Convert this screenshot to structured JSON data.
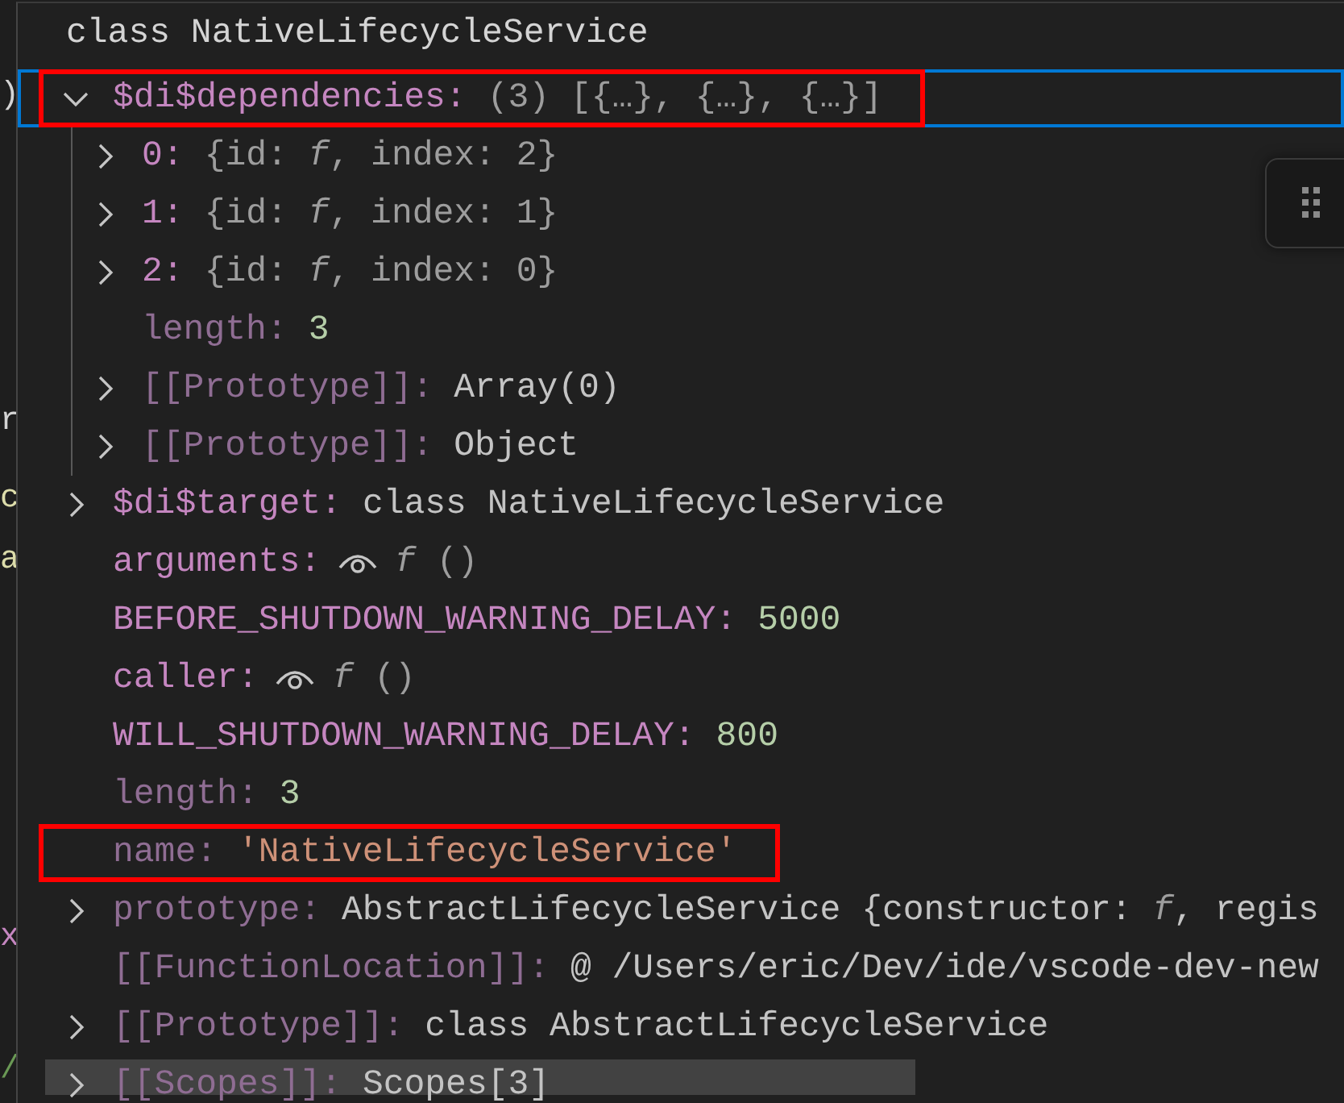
{
  "editor_fragments": [
    {
      "text": ")",
      "color": "#d4d4d4"
    },
    {
      "text": "r",
      "color": "#d4d4d4"
    },
    {
      "text": "c",
      "color": "#dcdcaa"
    },
    {
      "text": "a",
      "color": "#dcdcaa"
    },
    {
      "text": "x",
      "color": "#c586c0"
    },
    {
      "text": "/",
      "color": "#6a9955"
    }
  ],
  "hover": {
    "title": "class NativeLifecycleService",
    "rows": [
      {
        "name": "$di$dependencies:",
        "dim": false,
        "expanded": true,
        "selected": true,
        "annotated": true,
        "value": [
          {
            "text": "(3) [{…}, {…}, {…}]",
            "kind": "preview"
          }
        ],
        "children": [
          {
            "name": "0:",
            "dim": false,
            "expanded": false,
            "selected": false,
            "annotated": false,
            "value": [
              {
                "text": "{id: ",
                "kind": "preview"
              },
              {
                "text": "f",
                "kind": "function"
              },
              {
                "text": ", index: 2}",
                "kind": "preview"
              }
            ]
          },
          {
            "name": "1:",
            "dim": false,
            "expanded": false,
            "selected": false,
            "annotated": false,
            "value": [
              {
                "text": "{id: ",
                "kind": "preview"
              },
              {
                "text": "f",
                "kind": "function"
              },
              {
                "text": ", index: 1}",
                "kind": "preview"
              }
            ]
          },
          {
            "name": "2:",
            "dim": false,
            "expanded": false,
            "selected": false,
            "annotated": false,
            "value": [
              {
                "text": "{id: ",
                "kind": "preview"
              },
              {
                "text": "f",
                "kind": "function"
              },
              {
                "text": ", index: 0}",
                "kind": "preview"
              }
            ]
          },
          {
            "name": "length:",
            "dim": true,
            "selected": false,
            "annotated": false,
            "value": [
              {
                "text": "3",
                "kind": "number"
              }
            ]
          },
          {
            "name": "[[Prototype]]:",
            "dim": true,
            "expanded": false,
            "selected": false,
            "annotated": false,
            "value": [
              {
                "text": "Array(0)",
                "kind": "object"
              }
            ]
          },
          {
            "name": "[[Prototype]]:",
            "dim": true,
            "expanded": false,
            "selected": false,
            "annotated": false,
            "value": [
              {
                "text": "Object",
                "kind": "object"
              }
            ]
          }
        ]
      },
      {
        "name": "$di$target:",
        "dim": false,
        "expanded": false,
        "selected": false,
        "annotated": false,
        "value": [
          {
            "text": "class NativeLifecycleService",
            "kind": "object"
          }
        ]
      },
      {
        "name": "arguments:",
        "dim": false,
        "getter": true,
        "selected": false,
        "annotated": false,
        "value": [
          {
            "text": "f",
            "kind": "function"
          },
          {
            "text": " ()",
            "kind": "preview"
          }
        ]
      },
      {
        "name": "BEFORE_SHUTDOWN_WARNING_DELAY:",
        "dim": false,
        "selected": false,
        "annotated": false,
        "value": [
          {
            "text": "5000",
            "kind": "number"
          }
        ]
      },
      {
        "name": "caller:",
        "dim": false,
        "getter": true,
        "selected": false,
        "annotated": false,
        "value": [
          {
            "text": "f",
            "kind": "function"
          },
          {
            "text": " ()",
            "kind": "preview"
          }
        ]
      },
      {
        "name": "WILL_SHUTDOWN_WARNING_DELAY:",
        "dim": false,
        "selected": false,
        "annotated": false,
        "value": [
          {
            "text": "800",
            "kind": "number"
          }
        ]
      },
      {
        "name": "length:",
        "dim": true,
        "selected": false,
        "annotated": false,
        "value": [
          {
            "text": "3",
            "kind": "number"
          }
        ]
      },
      {
        "name": "name:",
        "dim": true,
        "selected": false,
        "annotated": true,
        "value": [
          {
            "text": "'NativeLifecycleService'",
            "kind": "string"
          }
        ]
      },
      {
        "name": "prototype:",
        "dim": true,
        "expanded": false,
        "selected": false,
        "annotated": false,
        "value": [
          {
            "text": "AbstractLifecycleService {constructor: ",
            "kind": "object"
          },
          {
            "text": "f",
            "kind": "function"
          },
          {
            "text": ", regis",
            "kind": "object"
          }
        ]
      },
      {
        "name": "[[FunctionLocation]]:",
        "dim": true,
        "selected": false,
        "annotated": false,
        "value": [
          {
            "text": "@ /Users/eric/Dev/ide/vscode-dev-new",
            "kind": "object"
          }
        ]
      },
      {
        "name": "[[Prototype]]:",
        "dim": true,
        "expanded": false,
        "selected": false,
        "annotated": false,
        "value": [
          {
            "text": "class AbstractLifecycleService",
            "kind": "object"
          }
        ]
      },
      {
        "name": "[[Scopes]]:",
        "dim": true,
        "expanded": false,
        "selected": false,
        "annotated": false,
        "value": [
          {
            "text": "Scopes[3]",
            "kind": "object"
          }
        ]
      }
    ]
  }
}
